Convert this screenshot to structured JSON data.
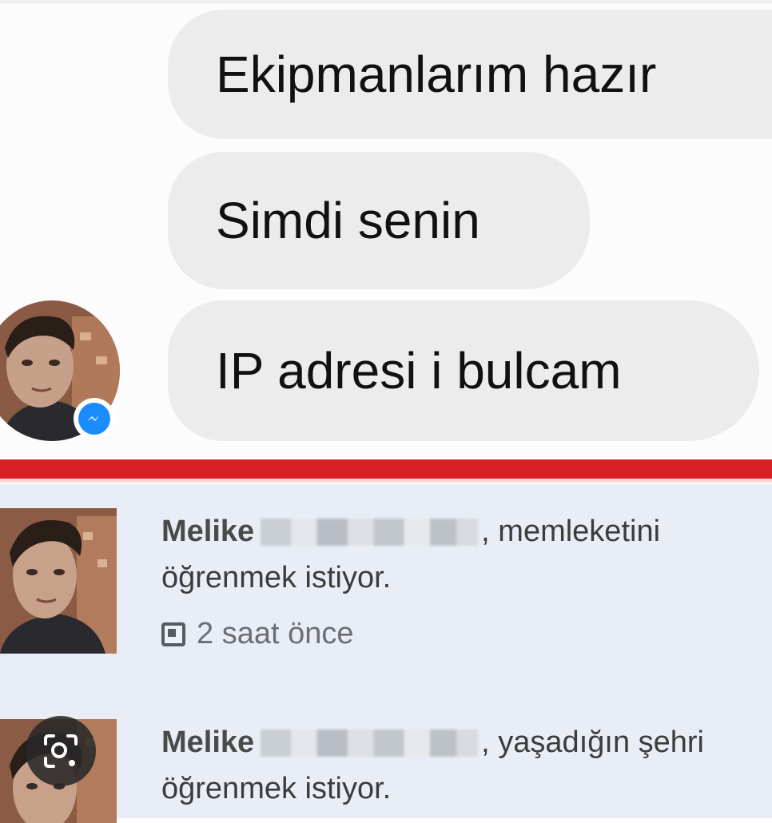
{
  "chat": {
    "messages": [
      {
        "text": "Ekipmanlarım hazır"
      },
      {
        "text": "Simdi senin"
      },
      {
        "text": "IP adresi i bulcam"
      }
    ],
    "badge_icon": "messenger-icon"
  },
  "notifications": [
    {
      "name": "Melike",
      "action": ", memleketini öğrenmek istiyor.",
      "time": "2 saat önce",
      "time_icon": "facebook-square-icon"
    },
    {
      "name": "Melike",
      "action": ", yaşadığın şehri öğrenmek istiyor."
    }
  ],
  "overlay": {
    "lens_icon": "lens-search-icon"
  },
  "colors": {
    "divider_red": "#d81f26",
    "notif_bg": "#e9eef6",
    "bubble_bg": "#ececec",
    "messenger_blue": "#1a8cff"
  }
}
